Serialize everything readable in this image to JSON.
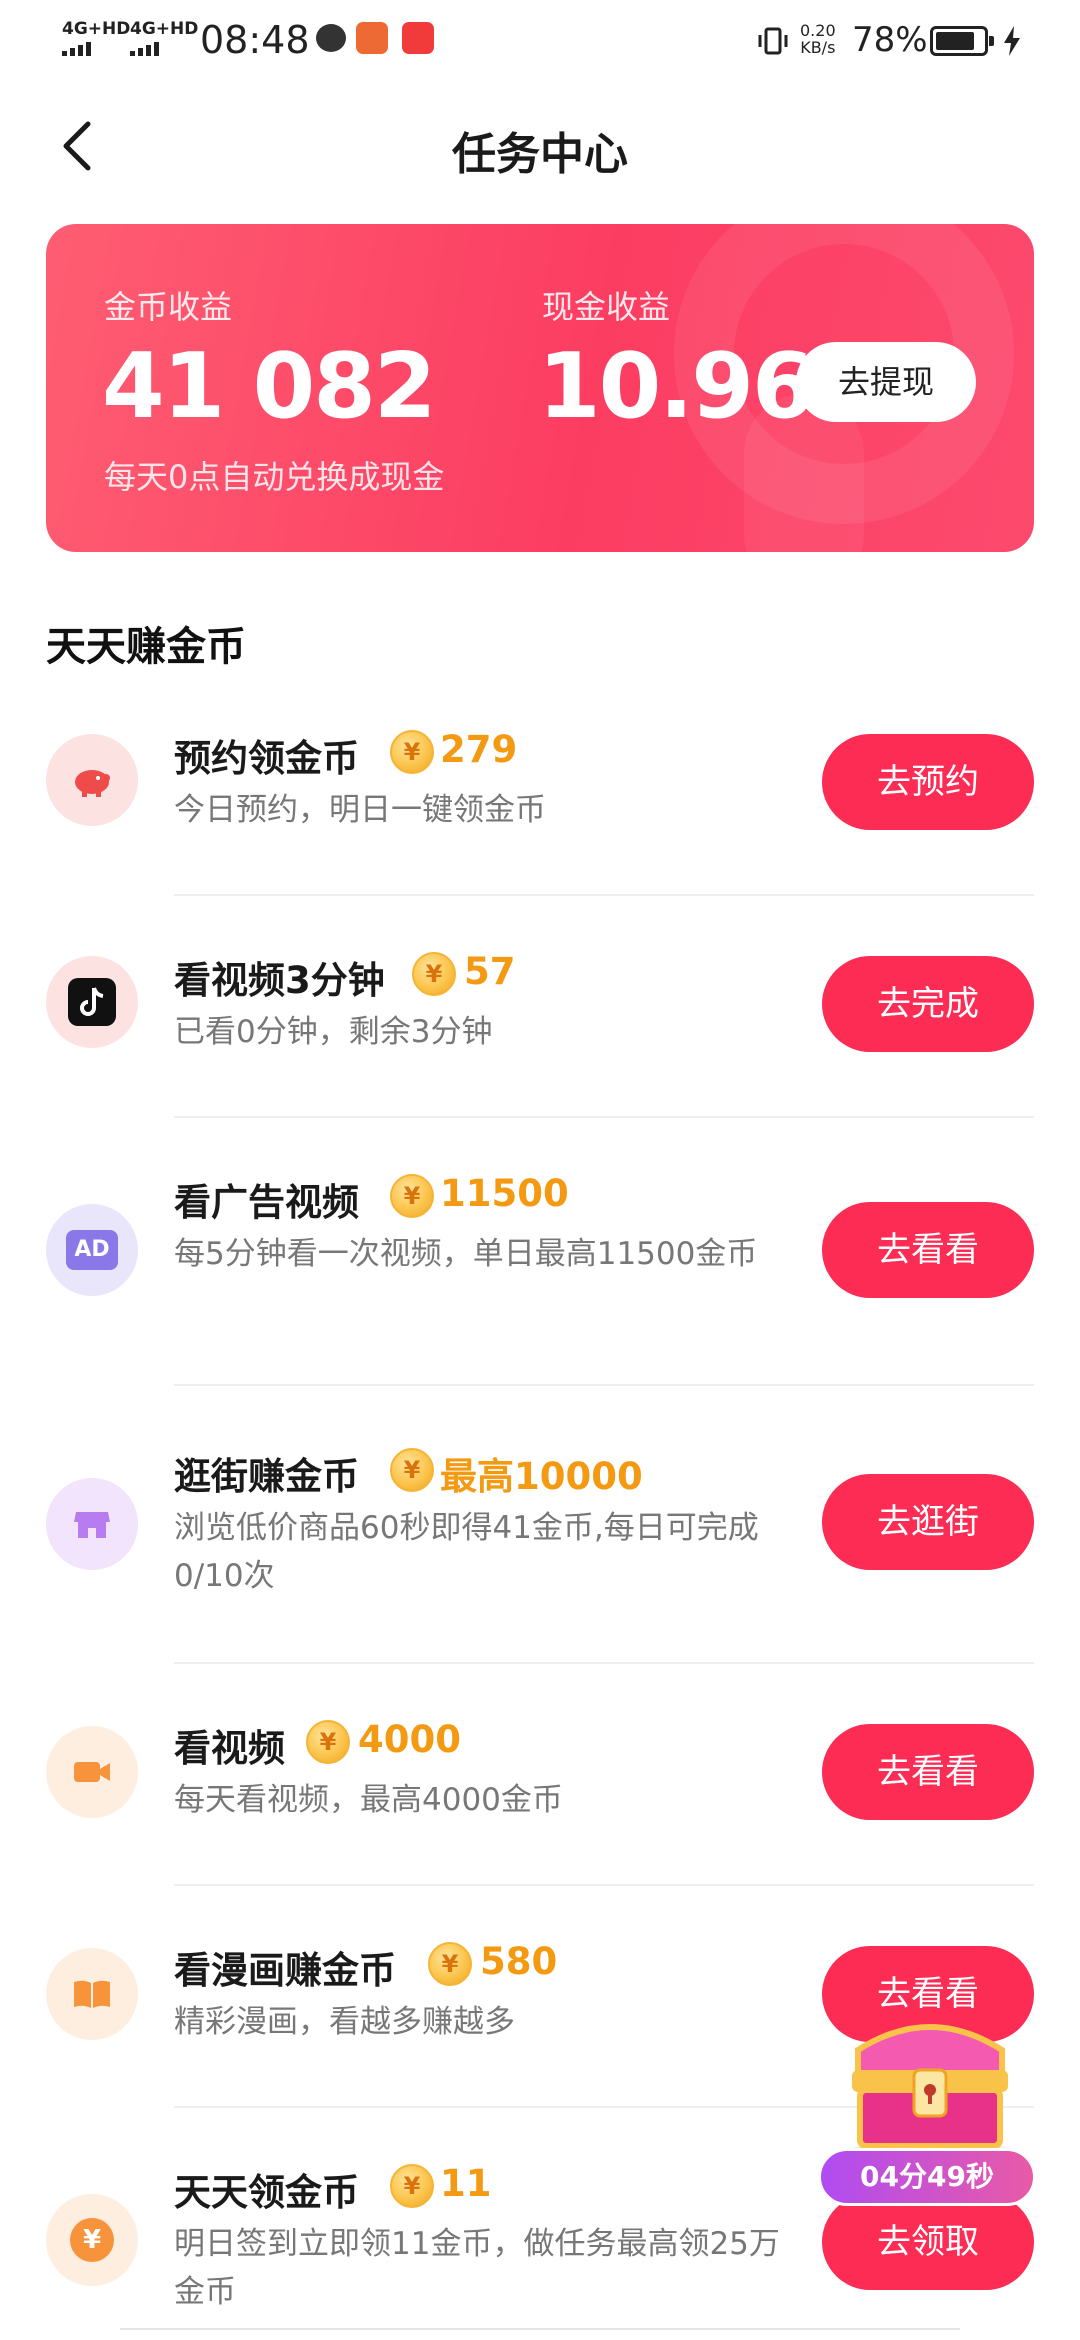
{
  "status_bar": {
    "network1": "4G+HD",
    "network2": "4G+HD",
    "time": "08:48",
    "speed_value": "0.20",
    "speed_unit": "KB/s",
    "battery": "78%"
  },
  "header": {
    "title": "任务中心"
  },
  "earnings": {
    "coin_label": "金币收益",
    "coin_value": "41 082",
    "cash_label": "现金收益",
    "cash_value": "10.96",
    "withdraw_label": "去提现",
    "note": "每天0点自动兑换成现金"
  },
  "section_title": "天天赚金币",
  "tasks": [
    {
      "name": "预约领金币",
      "reward": "279",
      "desc": "今日预约，明日一键领金币",
      "button": "去预约",
      "icon": "piggy-bank-icon",
      "icon_bg": "#fde2e2"
    },
    {
      "name": "看视频3分钟",
      "reward": "57",
      "desc": "已看0分钟，剩余3分钟",
      "button": "去完成",
      "icon": "tiktok-icon",
      "icon_bg": "#fde2e2"
    },
    {
      "name": "看广告视频",
      "reward": "11500",
      "desc": "每5分钟看一次视频，单日最高11500金币",
      "button": "去看看",
      "icon": "ad-icon",
      "icon_bg": "#e9e6fb"
    },
    {
      "name": "逛街赚金币",
      "reward": "最高10000",
      "desc": "浏览低价商品60秒即得41金币,每日可完成0/10次",
      "button": "去逛街",
      "icon": "shop-icon",
      "icon_bg": "#f1e4fc"
    },
    {
      "name": "看视频",
      "reward": "4000",
      "desc": "每天看视频，最高4000金币",
      "button": "去看看",
      "icon": "video-camera-icon",
      "icon_bg": "#fdeee0"
    },
    {
      "name": "看漫画赚金币",
      "reward": "580",
      "desc": "精彩漫画，看越多赚越多",
      "button": "去看看",
      "icon": "book-icon",
      "icon_bg": "#fdeee0"
    },
    {
      "name": "天天领金币",
      "reward": "11",
      "desc": "明日签到立即领11金币，做任务最高领25万金币",
      "button": "去领取",
      "icon": "yuan-coin-icon",
      "icon_bg": "#fdeee0"
    }
  ],
  "chest_timer": "04分49秒",
  "colors": {
    "accent": "#fd2c55",
    "reward": "#f39a12",
    "card_start": "#fe5d72",
    "card_end": "#fc3d62"
  }
}
